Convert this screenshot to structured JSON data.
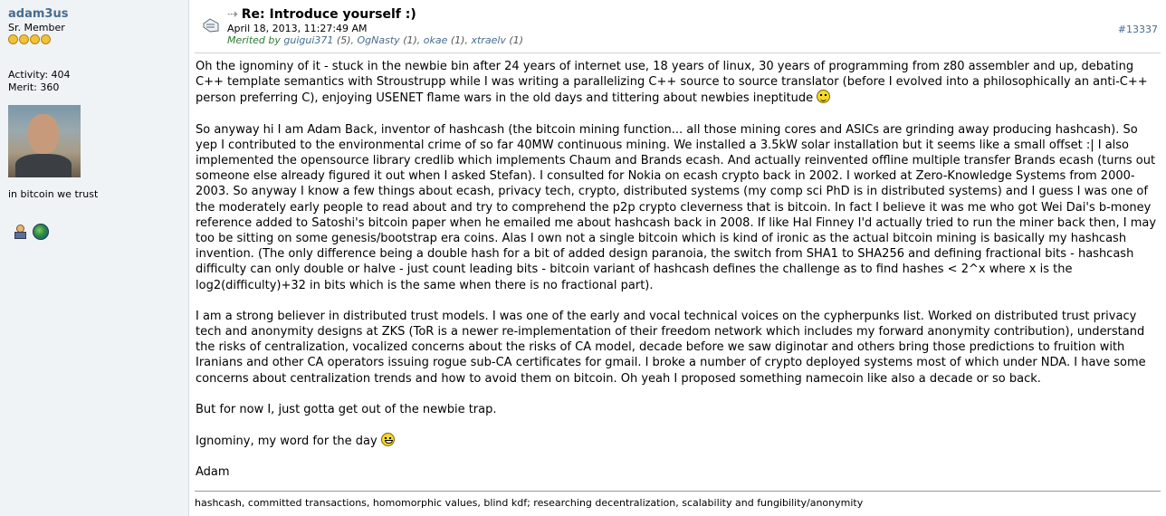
{
  "poster": {
    "username": "adam3us",
    "rank": "Sr. Member",
    "activity": "Activity: 404",
    "merit": "Merit: 360",
    "personal_text": "in bitcoin we trust",
    "star_count": 4,
    "star_color": "#f2c13a"
  },
  "post": {
    "arrow": "⇢",
    "subject": "Re: Introduce yourself :)",
    "date": "April 18, 2013, 11:27:49 AM",
    "merited_prefix": "Merited by",
    "merit_givers": [
      {
        "name": "guigui371",
        "count": "(5)"
      },
      {
        "name": "OgNasty",
        "count": "(1)"
      },
      {
        "name": "okae",
        "count": "(1)"
      },
      {
        "name": "xtraelv",
        "count": "(1)"
      }
    ],
    "post_number": "#13337",
    "paragraphs": {
      "p1": "Oh the ignominy of it - stuck in the newbie bin after 24 years of internet use, 18 years of linux, 30 years of programming from z80 assembler and up,  debating C++ template semantics with Stroustrupp while I was writing a parallelizing C++ source to source translator (before I evolved into a philosophically an anti-C++ person preferring C), enjoying USENET flame wars in the old days and tittering about newbies ineptitude",
      "p2": "So anyway hi I am Adam Back, inventor of hashcash (the bitcoin mining function... all those mining cores and ASICs are grinding away producing hashcash).  So yep I contributed to the environmental crime of so far 40MW continuous mining.  We installed a 3.5kW solar installation but it seems like a small offset :|  I also implemented the opensource library credlib which implements Chaum and Brands ecash.  And actually reinvented offline multiple transfer Brands ecash (turns out someone else already figured it out when I asked Stefan).  I consulted for Nokia on ecash crypto back in 2002.  I worked at Zero-Knowledge Systems from 2000-2003.  So anyway I know a few things about ecash, privacy tech, crypto, distributed systems (my comp sci PhD is in distributed systems) and I guess I was one of the moderately early people to read about and try to comprehend the p2p crypto cleverness that is bitcoin.  In fact I believe it was me who got Wei Dai's b-money reference added to Satoshi's bitcoin paper when he emailed me about hashcash back in 2008.  If like Hal Finney I'd actually tried to run the miner back then, I may too be sitting on some genesis/bootstrap era coins.  Alas I own not a single bitcoin which is kind of ironic as the actual bitcoin mining is basically my hashcash invention.  (The only difference being a double hash for a bit of added design paranoia, the switch from SHA1 to SHA256 and defining fractional bits - hashcash difficulty can only double or halve - just count leading bits - bitcoin variant of hashcash defines the challenge as to find hashes < 2^x where x is the log2(difficulty)+32 in bits which is the same when there is no fractional part).",
      "p3": "I am a strong believer in distributed trust models.  I was one of the early and vocal technical voices on the cypherpunks list.  Worked on distributed trust privacy tech and anonymity designs at ZKS (ToR is a newer re-implementation of their freedom network which includes my forward anonymity contribution), understand the risks of centralization, vocalized concerns about the risks of CA model, decade before we saw diginotar and others bring those predictions to fruition with Iranians and other CA operators issuing rogue sub-CA certificates for gmail.  I broke a number of crypto deployed systems most of which under NDA.  I have some concerns about centralization trends and how to avoid them on bitcoin.  Oh yeah I proposed something namecoin like also a decade or so back.",
      "p4": "But for now I, just gotta get out of the newbie trap.",
      "p5": "Ignominy, my word for the day",
      "p6": "Adam"
    },
    "signature": "hashcash, committed transactions, homomorphic values, blind kdf; researching decentralization, scalability and fungibility/anonymity"
  },
  "icons": [
    "topic-icon",
    "smiley-icon",
    "grin-icon",
    "profile-icon",
    "globe-icon"
  ],
  "colors": {
    "link": "#476c8e",
    "merited": "#2e7d32",
    "sidebar_bg": "#f0f3f6"
  }
}
